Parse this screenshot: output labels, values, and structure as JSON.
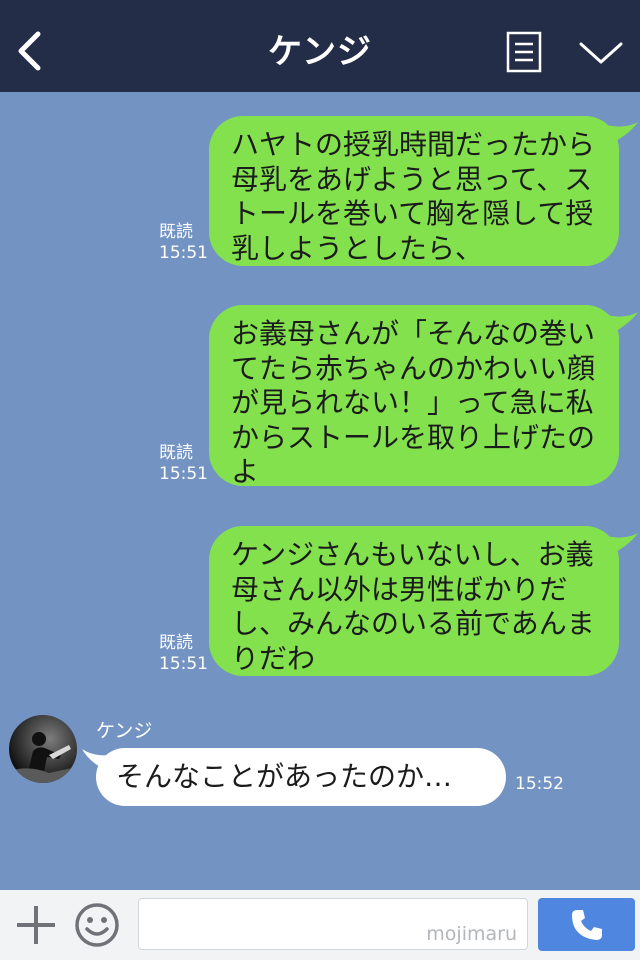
{
  "header": {
    "title": "ケンジ",
    "back_icon": "chevron-left-icon",
    "menu_icon": "document-list-icon",
    "collapse_icon": "chevron-down-icon",
    "background": "#242d47"
  },
  "chat": {
    "background": "#7393c3",
    "outgoing": [
      {
        "text": "ハヤトの授乳時間だったから母乳をあげようと思って、ストールを巻いて胸を隠して授乳しようとしたら、",
        "read": "既読",
        "time": "15:51"
      },
      {
        "text": "お義母さんが「そんなの巻いてたら赤ちゃんのかわいい顔が見られない！」って急に私からストールを取り上げたのよ",
        "read": "既読",
        "time": "15:51"
      },
      {
        "text": "ケンジさんもいないし、お義母さん以外は男性ばかりだし、みんなのいる前であんまりだわ",
        "read": "既読",
        "time": "15:51"
      }
    ],
    "incoming": {
      "sender": "ケンジ",
      "text": "そんなことがあったのか…",
      "time": "15:52"
    },
    "outgoing_bubble_color": "#84e14e",
    "incoming_bubble_color": "#ffffff"
  },
  "input_bar": {
    "plus_icon": "plus-icon",
    "emoji_icon": "smiley-icon",
    "input_value": "",
    "watermark": "mojimaru",
    "send_icon": "phone-icon",
    "send_color": "#4f86df"
  }
}
